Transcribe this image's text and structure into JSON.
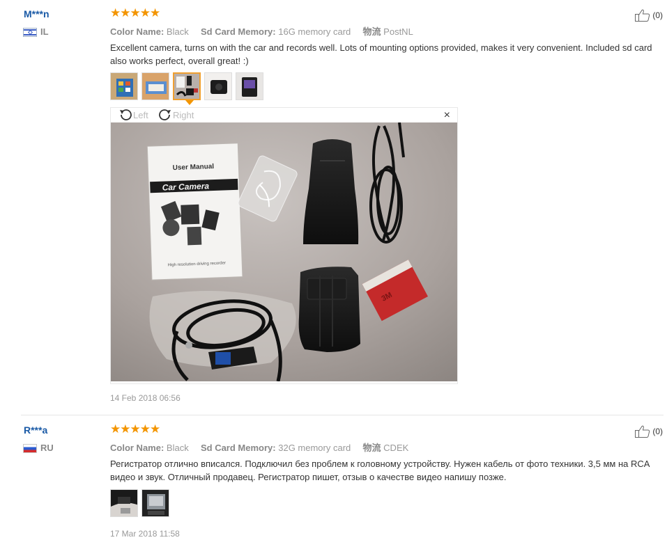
{
  "reviews": [
    {
      "user": "M***n",
      "country": "IL",
      "stars": "★★★★★",
      "attr_color_label": "Color Name:",
      "attr_color_value": "Black",
      "attr_sd_label": "Sd Card Memory:",
      "attr_sd_value": "16G memory card",
      "attr_ship_label": "物流",
      "attr_ship_value": "PostNL",
      "like_count": "(0)",
      "text": "Excellent camera, turns on with the car and records well. Lots of mounting options provided, makes it very convenient. Included sd card also works perfect, overall great! :)",
      "date": "14 Feb 2018 06:56",
      "viewer": {
        "rotate_left": "Left",
        "rotate_right": "Right",
        "close": "×",
        "manual_title": "User Manual",
        "manual_banner": "Car Camera",
        "manual_caption": "High resolution driving recorder",
        "sticker": "3M"
      }
    },
    {
      "user": "R***a",
      "country": "RU",
      "stars": "★★★★★",
      "attr_color_label": "Color Name:",
      "attr_color_value": "Black",
      "attr_sd_label": "Sd Card Memory:",
      "attr_sd_value": "32G memory card",
      "attr_ship_label": "物流",
      "attr_ship_value": "CDEK",
      "like_count": "(0)",
      "text": "Регистратор отлично вписался. Подключил без проблем к головному устройству. Нужен кабель от фото техники. 3,5 мм на RCA видео и звук. Отличный продавец. Регистратор пишет, отзыв о качестве видео напишу позже.",
      "date": "17 Mar 2018 11:58"
    }
  ]
}
